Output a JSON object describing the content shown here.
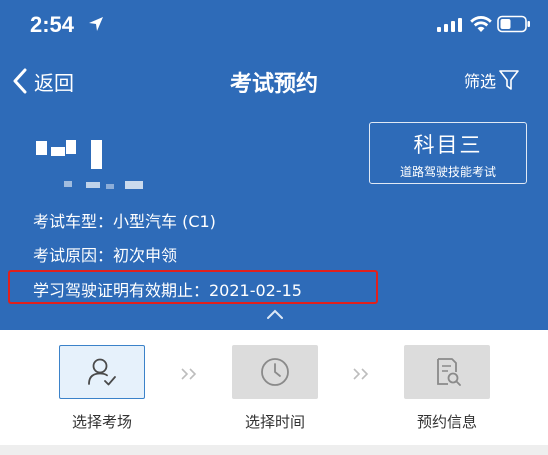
{
  "status_bar": {
    "time": "2:54"
  },
  "nav": {
    "back_label": "返回",
    "title": "考试预约",
    "filter_label": "筛选"
  },
  "subject": {
    "title": "科目三",
    "subtitle": "道路驾驶技能考试"
  },
  "info": {
    "vehicle_type": "考试车型：小型汽车 (C1)",
    "reason": "考试原因：初次申领",
    "permit_expiry": "学习驾驶证明有效期止：2021-02-15"
  },
  "steps": [
    {
      "label": "选择考场",
      "icon": "user-check-icon",
      "active": true
    },
    {
      "label": "选择时间",
      "icon": "clock-icon",
      "active": false
    },
    {
      "label": "预约信息",
      "icon": "document-search-icon",
      "active": false
    }
  ],
  "colors": {
    "header_bg": "#2e6bb8",
    "highlight": "#e0201c",
    "active_step_border": "#3b82c9",
    "active_step_bg": "#e6f1fb",
    "inactive_step_bg": "#dcdcdc"
  }
}
